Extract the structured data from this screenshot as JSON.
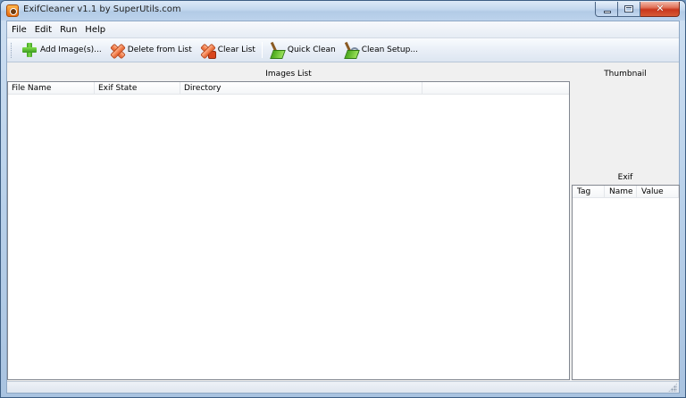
{
  "window": {
    "title": "ExifCleaner v1.1 by SuperUtils.com",
    "close_glyph": "✕"
  },
  "menu": [
    "File",
    "Edit",
    "Run",
    "Help"
  ],
  "toolbar": {
    "add_images": {
      "label": "Add Image(s)...",
      "icon": "plus-icon"
    },
    "delete_from_list": {
      "label": "Delete from List",
      "icon": "cross-icon"
    },
    "clear_list": {
      "label": "Clear List",
      "icon": "clear-list-icon"
    },
    "quick_clean": {
      "label": "Quick Clean",
      "icon": "broom-icon"
    },
    "clean_setup": {
      "label": "Clean Setup...",
      "icon": "broom-gear-icon"
    }
  },
  "images_list": {
    "caption": "Images List",
    "columns": [
      "File Name",
      "Exif State",
      "Directory",
      ""
    ]
  },
  "thumbnail": {
    "caption": "Thumbnail"
  },
  "exif": {
    "caption": "Exif",
    "columns": [
      "Tag",
      "Name",
      "Value"
    ]
  },
  "colors": {
    "frame": "#b9d1ea",
    "client": "#f0f0f0",
    "list_border": "#828790"
  }
}
